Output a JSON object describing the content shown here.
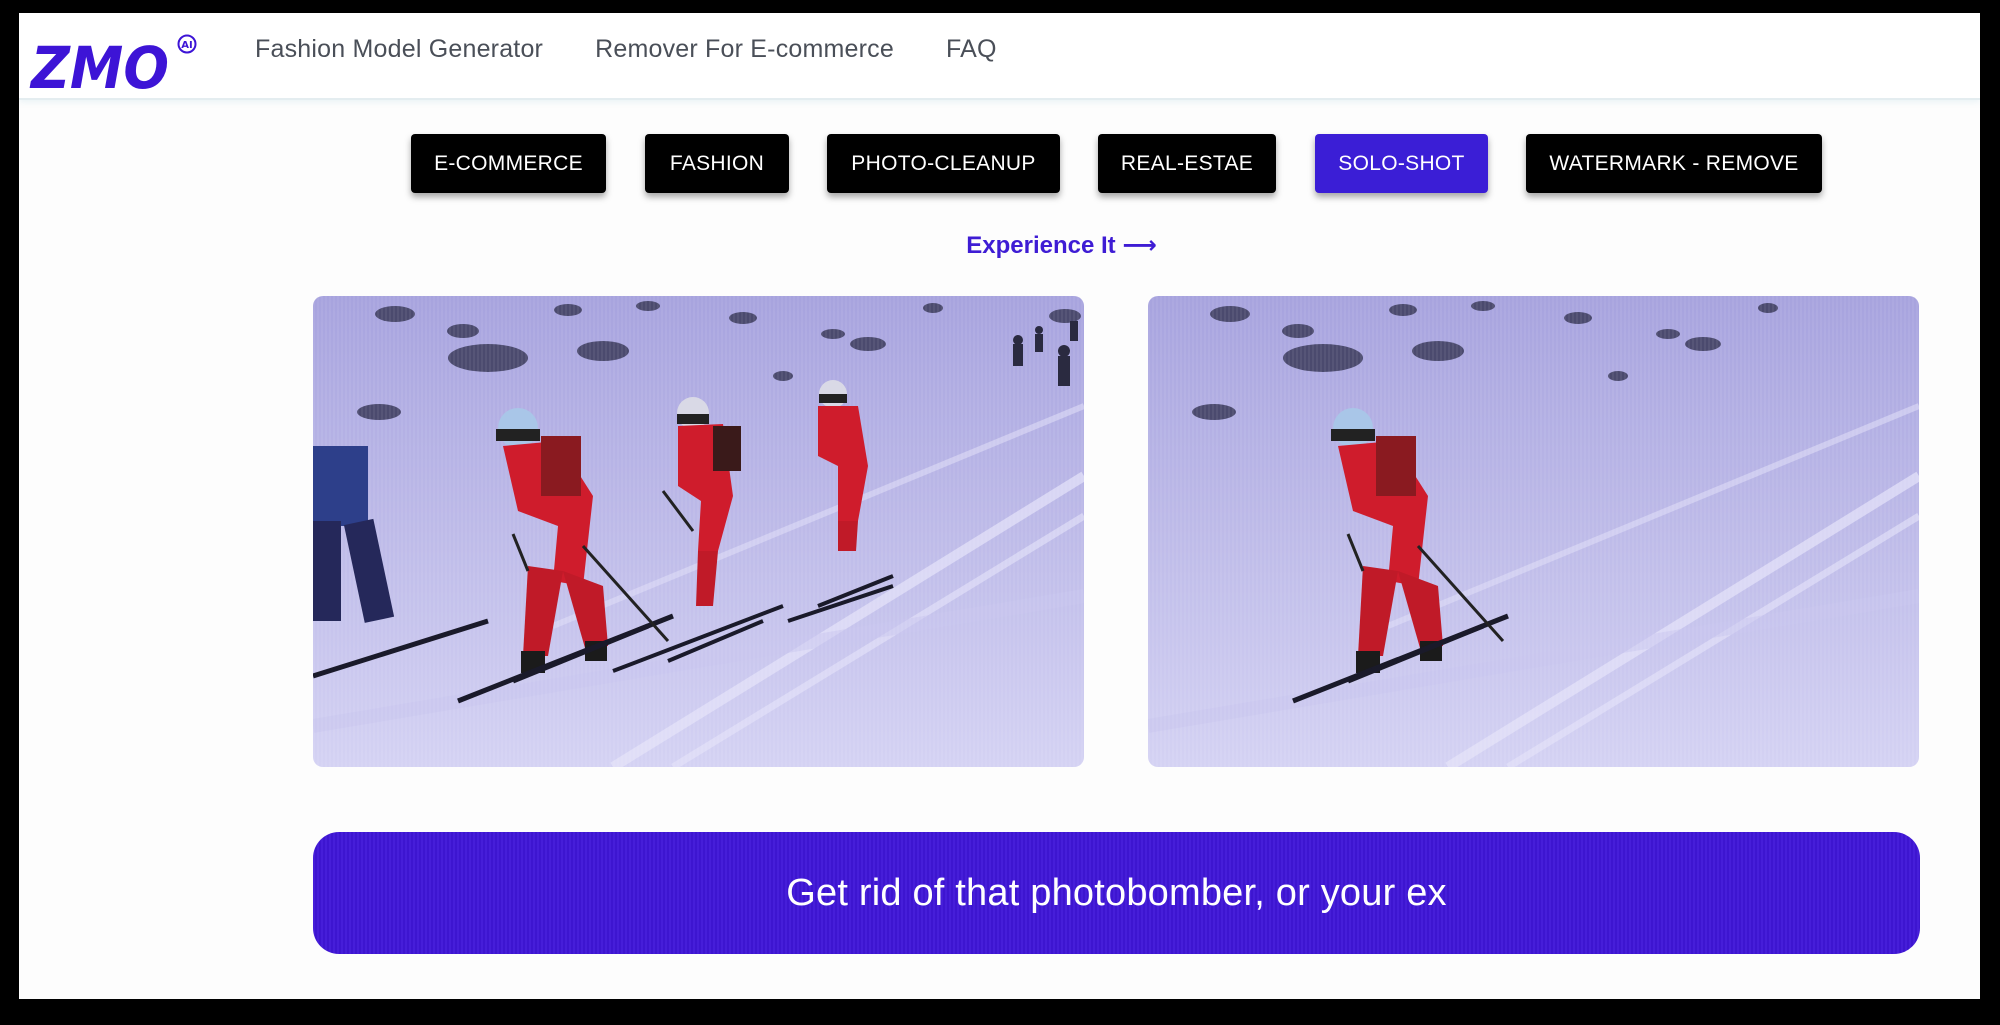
{
  "brand": {
    "logo_text": "ZMO",
    "logo_badge": "AI",
    "color": "#3d14d6"
  },
  "nav": {
    "links": [
      "Fashion Model Generator",
      "Remover For E-commerce",
      "FAQ"
    ]
  },
  "tabs": [
    {
      "label": "E-COMMERCE",
      "active": false
    },
    {
      "label": "FASHION",
      "active": false
    },
    {
      "label": "PHOTO-CLEANUP",
      "active": false
    },
    {
      "label": "REAL-ESTAE",
      "active": false
    },
    {
      "label": "SOLO-SHOT",
      "active": true
    },
    {
      "label": "WATERMARK - REMOVE",
      "active": false
    }
  ],
  "experience_link": "Experience It ⟶",
  "images": {
    "before": {
      "description_icon": "image-icon"
    },
    "after": {
      "description_icon": "image-icon"
    }
  },
  "cta": {
    "label": "Get rid of that photobomber, or your ex"
  },
  "colors": {
    "accent": "#3d14d6",
    "tab_bg": "#000000",
    "snow": "#b9b6e8"
  }
}
